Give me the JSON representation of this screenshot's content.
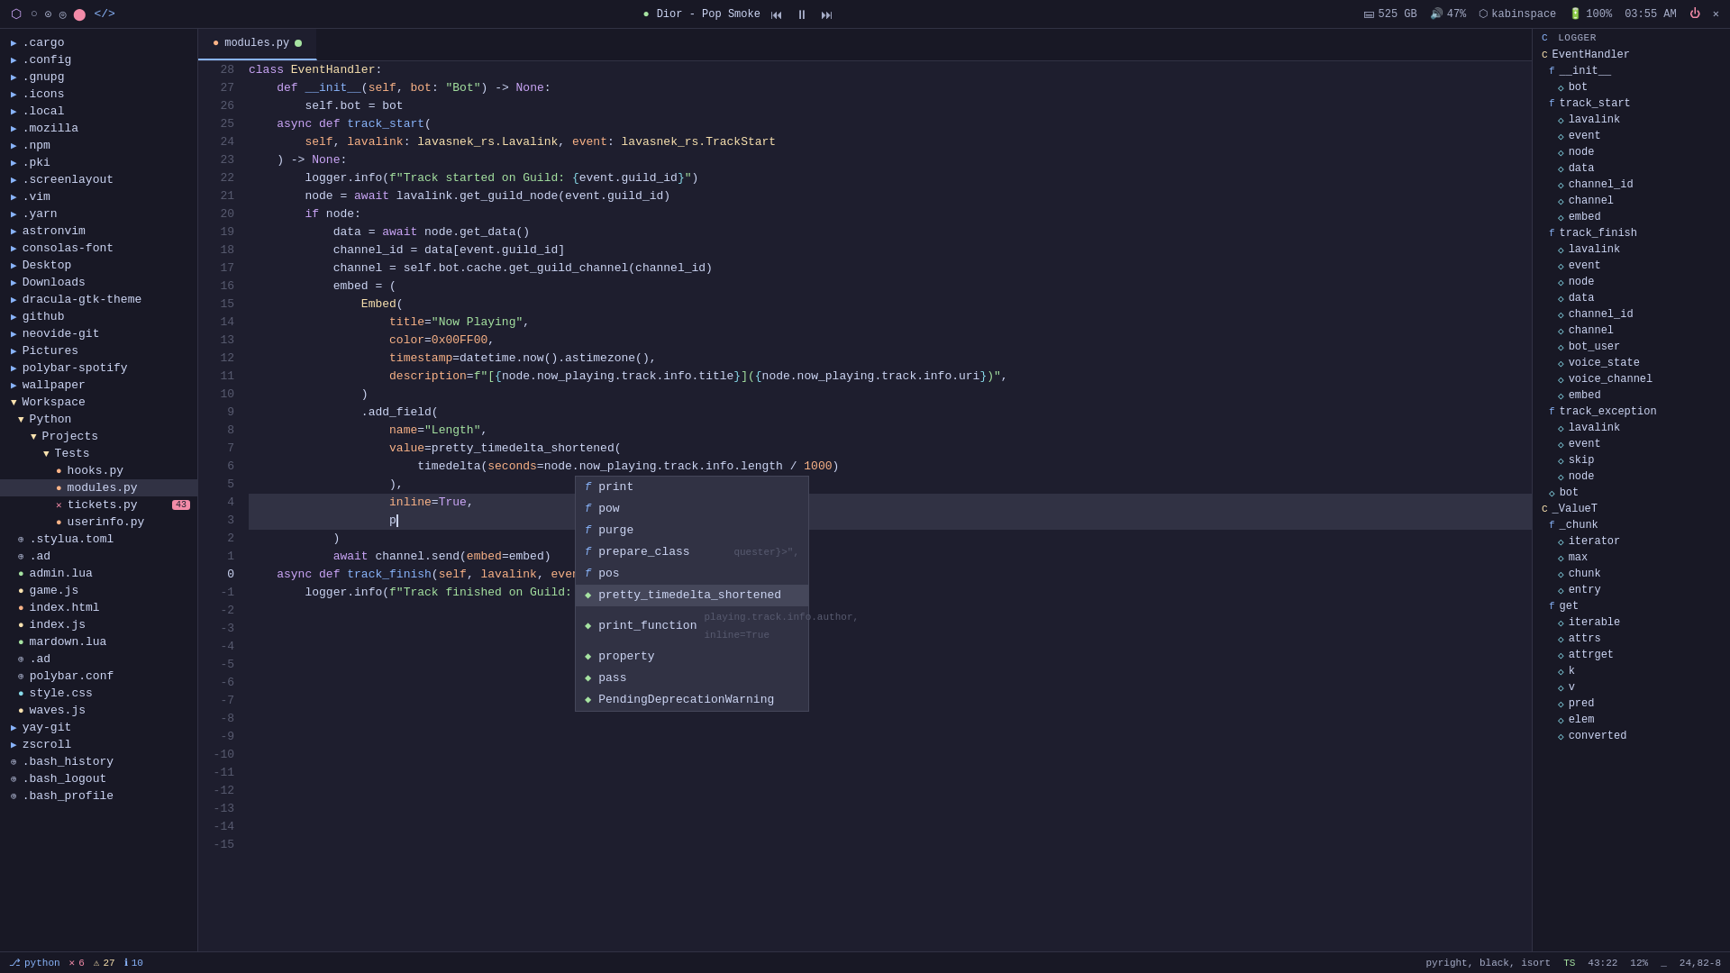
{
  "topbar": {
    "terminal_icon": "⬡",
    "icons": [
      "○",
      "⊙",
      "◎",
      "⬤",
      "</>"
    ],
    "song": "Dior - Pop Smoke",
    "media": {
      "prev": "⏮",
      "pause": "⏸",
      "next": "⏭"
    },
    "system": {
      "hdd": "🖴",
      "hdd_label": "525 GB",
      "vol_icon": "🔊",
      "vol_val": "47%",
      "net_icon": "⬡",
      "net_label": "kabinspace",
      "bat_icon": "🔋",
      "bat_val": "100%",
      "clock": "03:55 AM",
      "power": "⏻"
    }
  },
  "sidebar": {
    "items": [
      {
        "label": ".cargo",
        "type": "folder",
        "indent": 0
      },
      {
        "label": ".config",
        "type": "folder",
        "indent": 0
      },
      {
        "label": ".gnupg",
        "type": "folder",
        "indent": 0
      },
      {
        "label": ".icons",
        "type": "folder",
        "indent": 0
      },
      {
        "label": ".local",
        "type": "folder",
        "indent": 0
      },
      {
        "label": ".mozilla",
        "type": "folder",
        "indent": 0
      },
      {
        "label": ".npm",
        "type": "folder",
        "indent": 0
      },
      {
        "label": ".pki",
        "type": "folder",
        "indent": 0
      },
      {
        "label": ".screenlayout",
        "type": "folder",
        "indent": 0
      },
      {
        "label": ".vim",
        "type": "folder",
        "indent": 0
      },
      {
        "label": ".yarn",
        "type": "folder",
        "indent": 0
      },
      {
        "label": "astronvim",
        "type": "folder",
        "indent": 0
      },
      {
        "label": "consolas-font",
        "type": "folder",
        "indent": 0
      },
      {
        "label": "Desktop",
        "type": "folder",
        "indent": 0
      },
      {
        "label": "Downloads",
        "type": "folder",
        "indent": 0
      },
      {
        "label": "dracula-gtk-theme",
        "type": "folder",
        "indent": 0
      },
      {
        "label": "github",
        "type": "folder",
        "indent": 0
      },
      {
        "label": "neovide-git",
        "type": "folder",
        "indent": 0
      },
      {
        "label": "Pictures",
        "type": "folder",
        "indent": 0
      },
      {
        "label": "polybar-spotify",
        "type": "folder",
        "indent": 0
      },
      {
        "label": "wallpaper",
        "type": "folder",
        "indent": 0
      },
      {
        "label": "Workspace",
        "type": "folder",
        "indent": 0,
        "open": true
      },
      {
        "label": "Python",
        "type": "folder",
        "indent": 1,
        "open": true
      },
      {
        "label": "Projects",
        "type": "folder",
        "indent": 2,
        "open": true
      },
      {
        "label": "Tests",
        "type": "folder",
        "indent": 3,
        "open": true
      },
      {
        "label": "hooks.py",
        "type": "py",
        "indent": 4
      },
      {
        "label": "modules.py",
        "type": "py",
        "indent": 4,
        "selected": true
      },
      {
        "label": "tickets.py",
        "type": "py",
        "indent": 4,
        "error": 43
      },
      {
        "label": "userinfo.py",
        "type": "py",
        "indent": 4
      },
      {
        "label": ".stylua.toml",
        "type": "file",
        "indent": 1
      },
      {
        "label": ".ad",
        "type": "file",
        "indent": 1
      },
      {
        "label": "admin.lua",
        "type": "lua",
        "indent": 1
      },
      {
        "label": "game.js",
        "type": "js",
        "indent": 1
      },
      {
        "label": "index.html",
        "type": "html",
        "indent": 1
      },
      {
        "label": "index.js",
        "type": "js",
        "indent": 1
      },
      {
        "label": "mardown.lua",
        "type": "lua",
        "indent": 1
      },
      {
        "label": ".ad",
        "type": "file",
        "indent": 1
      },
      {
        "label": "polybar.conf",
        "type": "file",
        "indent": 1
      },
      {
        "label": "style.css",
        "type": "css",
        "indent": 1
      },
      {
        "label": "waves.js",
        "type": "js",
        "indent": 1
      },
      {
        "label": "yay-git",
        "type": "folder",
        "indent": 0
      },
      {
        "label": "zscroll",
        "type": "folder",
        "indent": 0
      },
      {
        "label": ".bash_history",
        "type": "file",
        "indent": 0
      },
      {
        "label": ".bash_logout",
        "type": "file",
        "indent": 0
      },
      {
        "label": ".bash_profile",
        "type": "file",
        "indent": 0
      }
    ]
  },
  "editor": {
    "tab": "modules.py",
    "tab_modified": true
  },
  "outline": {
    "header": "logger",
    "items": [
      {
        "label": "EventHandler",
        "type": "c",
        "indent": 0
      },
      {
        "label": "__init__",
        "type": "f",
        "indent": 1
      },
      {
        "label": "bot",
        "type": "v",
        "indent": 2
      },
      {
        "label": "track_start",
        "type": "f",
        "indent": 1
      },
      {
        "label": "lavalink",
        "type": "v",
        "indent": 2
      },
      {
        "label": "event",
        "type": "v",
        "indent": 2
      },
      {
        "label": "node",
        "type": "v",
        "indent": 2
      },
      {
        "label": "data",
        "type": "v",
        "indent": 2
      },
      {
        "label": "channel_id",
        "type": "v",
        "indent": 2
      },
      {
        "label": "channel",
        "type": "v",
        "indent": 2
      },
      {
        "label": "embed",
        "type": "v",
        "indent": 2
      },
      {
        "label": "track_finish",
        "type": "f",
        "indent": 1
      },
      {
        "label": "lavalink",
        "type": "v",
        "indent": 2
      },
      {
        "label": "event",
        "type": "v",
        "indent": 2
      },
      {
        "label": "node",
        "type": "v",
        "indent": 2
      },
      {
        "label": "data",
        "type": "v",
        "indent": 2
      },
      {
        "label": "channel_id",
        "type": "v",
        "indent": 2
      },
      {
        "label": "channel",
        "type": "v",
        "indent": 2
      },
      {
        "label": "bot_user",
        "type": "v",
        "indent": 2
      },
      {
        "label": "voice_state",
        "type": "v",
        "indent": 2
      },
      {
        "label": "voice_channel",
        "type": "v",
        "indent": 2
      },
      {
        "label": "embed",
        "type": "v",
        "indent": 2
      },
      {
        "label": "track_exception",
        "type": "f",
        "indent": 1
      },
      {
        "label": "lavalink",
        "type": "v",
        "indent": 2
      },
      {
        "label": "event",
        "type": "v",
        "indent": 2
      },
      {
        "label": "skip",
        "type": "v",
        "indent": 2
      },
      {
        "label": "node",
        "type": "v",
        "indent": 2
      },
      {
        "label": "bot",
        "type": "v",
        "indent": 1
      },
      {
        "label": "_ValueT",
        "type": "c",
        "indent": 0
      },
      {
        "label": "_chunk",
        "type": "f",
        "indent": 1
      },
      {
        "label": "iterator",
        "type": "v",
        "indent": 2
      },
      {
        "label": "max",
        "type": "v",
        "indent": 2
      },
      {
        "label": "chunk",
        "type": "v",
        "indent": 2
      },
      {
        "label": "entry",
        "type": "v",
        "indent": 2
      },
      {
        "label": "get",
        "type": "f",
        "indent": 1
      },
      {
        "label": "iterable",
        "type": "v",
        "indent": 2
      },
      {
        "label": "attrs",
        "type": "v",
        "indent": 2
      },
      {
        "label": "attrget",
        "type": "v",
        "indent": 2
      },
      {
        "label": "k",
        "type": "v",
        "indent": 2
      },
      {
        "label": "v",
        "type": "v",
        "indent": 2
      },
      {
        "label": "pred",
        "type": "v",
        "indent": 2
      },
      {
        "label": "elem",
        "type": "v",
        "indent": 2
      },
      {
        "label": "converted",
        "type": "v",
        "indent": 2
      }
    ]
  },
  "autocomplete": {
    "items": [
      {
        "icon": "f",
        "label": "print"
      },
      {
        "icon": "f",
        "label": "pow"
      },
      {
        "icon": "f",
        "label": "purge"
      },
      {
        "icon": "f",
        "label": "prepare_class"
      },
      {
        "icon": "f",
        "label": "pos"
      },
      {
        "icon": "s",
        "label": "pretty_timedelta_shortened"
      },
      {
        "icon": "s",
        "label": "print_function"
      },
      {
        "icon": "s",
        "label": "property"
      },
      {
        "icon": "s",
        "label": "pass"
      },
      {
        "icon": "s",
        "label": "PendingDeprecationWarning"
      }
    ]
  },
  "statusbar": {
    "branch": "python",
    "errors": "6",
    "warnings": "27",
    "info": "10",
    "lsp": "pyright, black, isort",
    "ts": "TS",
    "position": "43:22",
    "pct": "12%",
    "cursor": "_",
    "col": "24,82-8"
  },
  "lines": [
    {
      "num": 28,
      "text": "class EventHandler:"
    },
    {
      "num": 27,
      "text": "    def __init__(self, bot: \"Bot\") -> None:"
    },
    {
      "num": 26,
      "text": "        self.bot = bot"
    },
    {
      "num": 25,
      "text": ""
    },
    {
      "num": 24,
      "text": "    async def track_start("
    },
    {
      "num": 23,
      "text": "        self, lavalink: lavasnek_rs.Lavalink, event: lavasnek_rs.TrackStart"
    },
    {
      "num": 22,
      "text": "    ) -> None:"
    },
    {
      "num": 21,
      "text": "        logger.info(f\"Track started on Guild: {event.guild_id}\")"
    },
    {
      "num": 20,
      "text": "        node = await lavalink.get_guild_node(event.guild_id)"
    },
    {
      "num": 19,
      "text": ""
    },
    {
      "num": 18,
      "text": "        if node:"
    },
    {
      "num": 17,
      "text": "            data = await node.get_data()"
    },
    {
      "num": 16,
      "text": "            channel_id = data[event.guild_id]"
    },
    {
      "num": 15,
      "text": "            channel = self.bot.cache.get_guild_channel(channel_id)"
    },
    {
      "num": 14,
      "text": ""
    },
    {
      "num": 13,
      "text": "            embed = ("
    },
    {
      "num": 12,
      "text": "                Embed("
    },
    {
      "num": 11,
      "text": "                    title=\"Now Playing\","
    },
    {
      "num": 10,
      "text": "                    color=0x00FF00,"
    },
    {
      "num": 9,
      "text": "                    timestamp=datetime.now().astimezone(),"
    },
    {
      "num": 8,
      "text": "                    description=f\"[{node.now_playing.track.info.title}]({node.now_playing.track.info.uri})\","
    },
    {
      "num": 7,
      "text": "                )"
    },
    {
      "num": 6,
      "text": "                .add_field("
    },
    {
      "num": 5,
      "text": "                    name=\"Length\","
    },
    {
      "num": 4,
      "text": "                    value=pretty_timedelta_shortened("
    },
    {
      "num": 3,
      "text": "                        timedelta(seconds=node.now_playing.track.info.length / 1000)"
    },
    {
      "num": 2,
      "text": "                    ),"
    },
    {
      "num": 1,
      "text": "                    inline=True,"
    },
    {
      "num": 0,
      "text": "                    p"
    }
  ]
}
